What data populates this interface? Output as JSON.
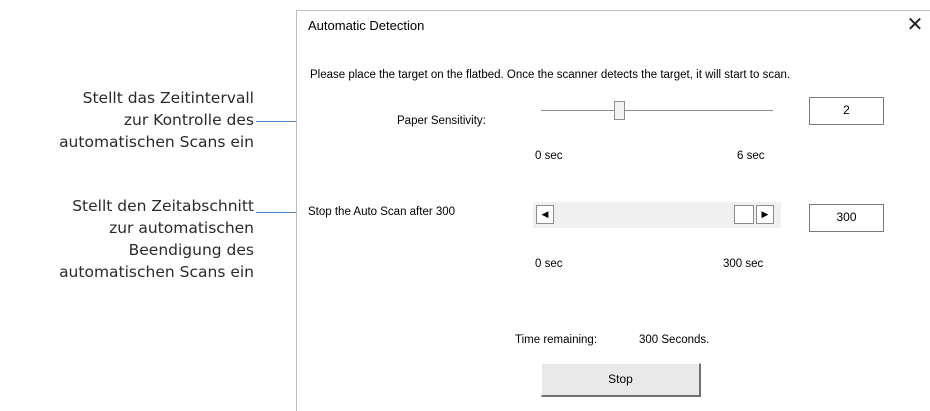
{
  "annotations": {
    "sensitivity_lines": [
      "Stellt das Zeitintervall",
      "zur Kontrolle des",
      "automatischen Scans ein"
    ],
    "stop_lines": [
      "Stellt den Zeitabschnitt",
      "zur automatischen",
      "Beendigung des",
      "automatischen Scans ein"
    ]
  },
  "dialog": {
    "title": "Automatic Detection",
    "close_glyph": "✕",
    "instruction": "Please place the target on the flatbed. Once the scanner detects the target, it will start to scan.",
    "sensitivity": {
      "label": "Paper Sensitivity:",
      "value": "2",
      "min_label": "0 sec",
      "max_label": "6 sec",
      "min": 0,
      "max": 6,
      "current": 2
    },
    "auto_stop": {
      "label": "Stop the Auto Scan after 300",
      "value": "300",
      "min_label": "0 sec",
      "max_label": "300 sec",
      "left_arrow": "◀",
      "right_arrow": "▶"
    },
    "remaining": {
      "label": "Time remaining:",
      "value": "300 Seconds."
    },
    "stop_button": "Stop"
  },
  "colors": {
    "leader_line": "#4a8bd0",
    "dialog_bg": "#ffffff",
    "button_face": "#e9e9e9"
  }
}
